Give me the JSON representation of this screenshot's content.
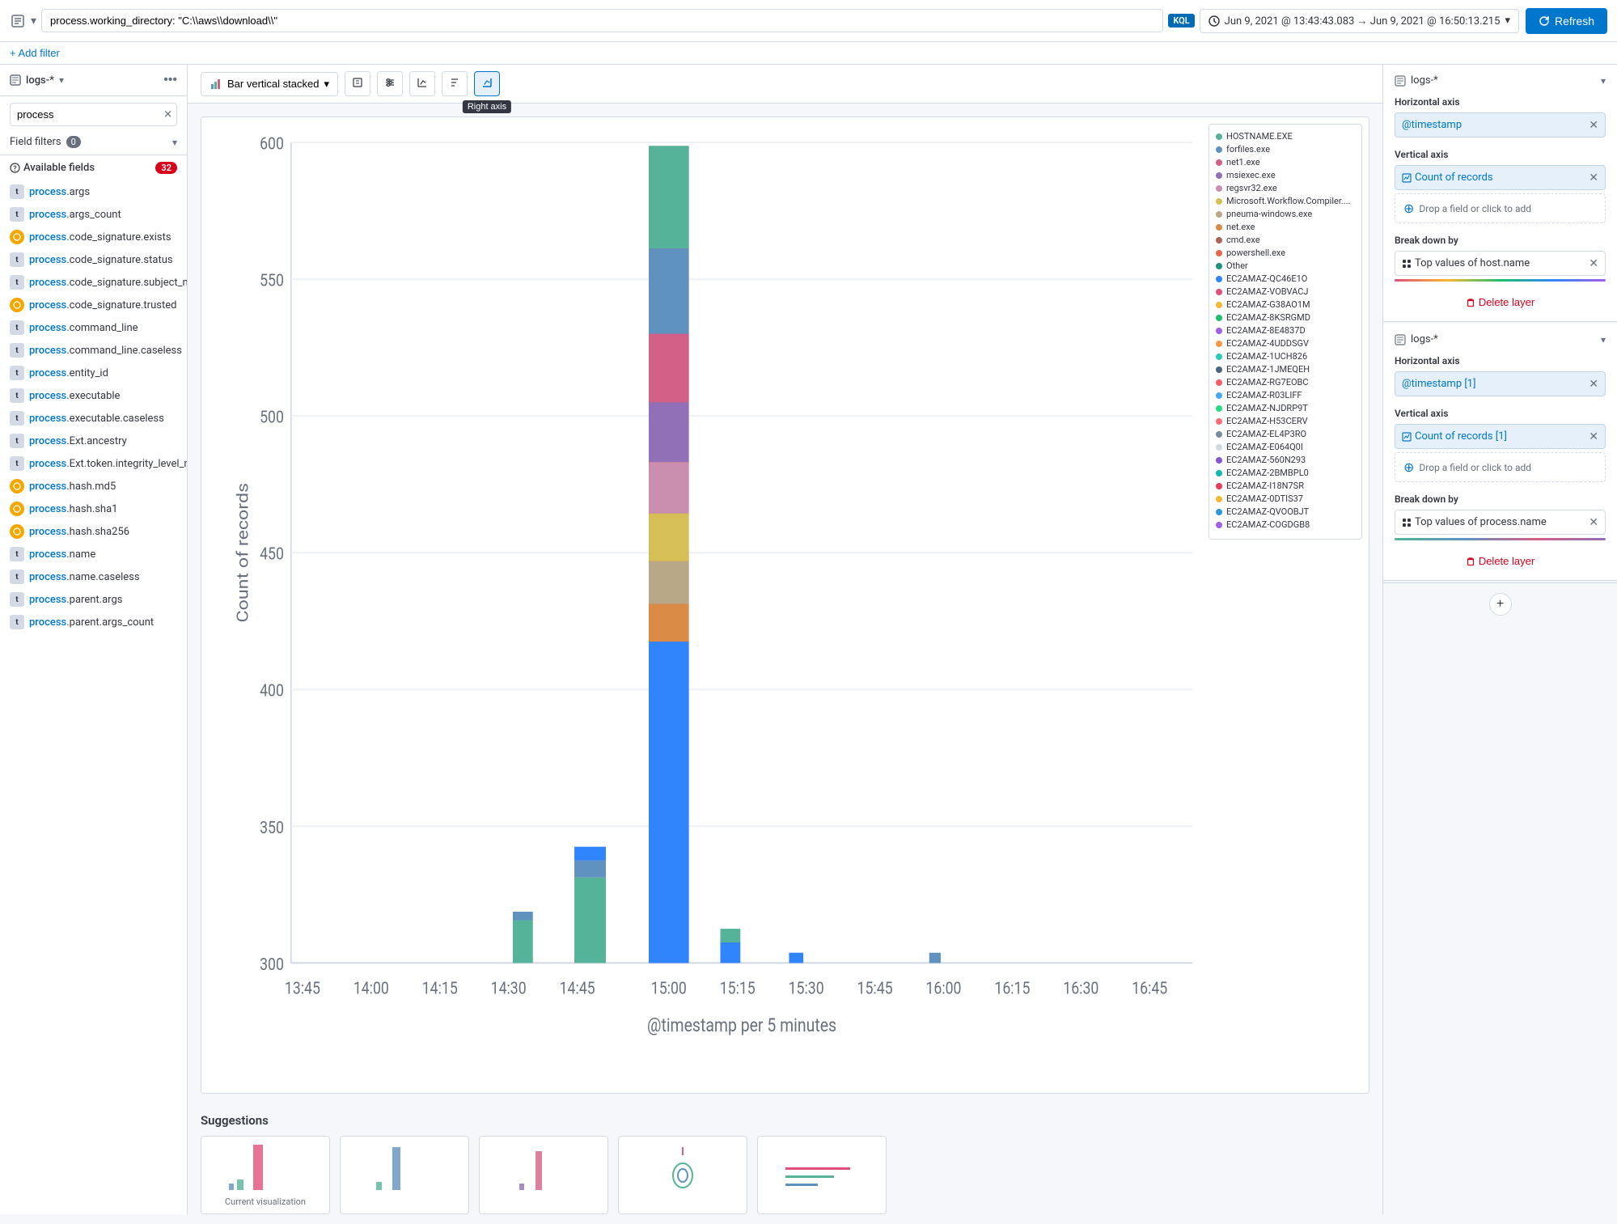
{
  "topbar": {
    "query": "process.working_directory: \"C:\\\\aws\\\\download\\\\\"",
    "kql_label": "KQL",
    "time_range": "Jun 9, 2021 @ 13:43:43.083  →  Jun 9, 2021 @ 16:50:13.215",
    "refresh_label": "Refresh"
  },
  "filter_bar": {
    "add_filter_label": "+ Add filter"
  },
  "sidebar": {
    "index": "logs-*",
    "search_placeholder": "process",
    "field_filters_label": "Field filters",
    "field_filters_count": "0",
    "available_fields_label": "Available fields",
    "available_fields_count": "32",
    "fields": [
      {
        "name": "process.args",
        "type": "t",
        "prefix": "process",
        "suffix": ".args"
      },
      {
        "name": "process.args_count",
        "type": "t",
        "prefix": "process",
        "suffix": ".args_count"
      },
      {
        "name": "process.code_signature.exists",
        "type": "bool",
        "prefix": "process",
        "suffix": ".code_signature.exists"
      },
      {
        "name": "process.code_signature.status",
        "type": "t",
        "prefix": "process",
        "suffix": ".code_signature.status"
      },
      {
        "name": "process.code_signature.subject_name",
        "type": "t",
        "prefix": "process",
        "suffix": ".code_signature.subject_name"
      },
      {
        "name": "process.code_signature.trusted",
        "type": "bool",
        "prefix": "process",
        "suffix": ".code_signature.trusted"
      },
      {
        "name": "process.command_line",
        "type": "t",
        "prefix": "process",
        "suffix": ".command_line"
      },
      {
        "name": "process.command_line.caseless",
        "type": "t",
        "prefix": "process",
        "suffix": ".command_line.caseless"
      },
      {
        "name": "process.entity_id",
        "type": "t",
        "prefix": "process",
        "suffix": ".entity_id"
      },
      {
        "name": "process.executable",
        "type": "t",
        "prefix": "process",
        "suffix": ".executable"
      },
      {
        "name": "process.executable.caseless",
        "type": "t",
        "prefix": "process",
        "suffix": ".executable.caseless"
      },
      {
        "name": "process.Ext.ancestry",
        "type": "t",
        "prefix": "process",
        "suffix": ".Ext.ancestry"
      },
      {
        "name": "process.Ext.token.integrity_level_name",
        "type": "t",
        "prefix": "process",
        "suffix": ".Ext.token.integrity_level_name"
      },
      {
        "name": "process.hash.md5",
        "type": "hash",
        "prefix": "process",
        "suffix": ".hash.md5"
      },
      {
        "name": "process.hash.sha1",
        "type": "hash",
        "prefix": "process",
        "suffix": ".hash.sha1"
      },
      {
        "name": "process.hash.sha256",
        "type": "hash",
        "prefix": "process",
        "suffix": ".hash.sha256"
      },
      {
        "name": "process.name",
        "type": "t",
        "prefix": "process",
        "suffix": ".name"
      },
      {
        "name": "process.name.caseless",
        "type": "t",
        "prefix": "process",
        "suffix": ".name.caseless"
      },
      {
        "name": "process.parent.args",
        "type": "t",
        "prefix": "process",
        "suffix": ".parent.args"
      },
      {
        "name": "process.parent.args_count",
        "type": "t",
        "prefix": "process",
        "suffix": ".parent.args_count"
      }
    ]
  },
  "chart_toolbar": {
    "chart_type": "Bar vertical stacked",
    "tooltip_label": "Right axis"
  },
  "chart": {
    "y_label": "Count of records",
    "x_label": "@timestamp per 5 minutes",
    "x_ticks": [
      "13:45",
      "14:00",
      "14:15",
      "14:30",
      "14:45",
      "15:00",
      "15:15",
      "15:30",
      "15:45",
      "16:00",
      "16:15",
      "16:30",
      "16:45"
    ]
  },
  "legend": {
    "items": [
      {
        "label": "HOSTNAME.EXE",
        "color": "#54b399"
      },
      {
        "label": "forfiles.exe",
        "color": "#6092c0"
      },
      {
        "label": "net1.exe",
        "color": "#d36086"
      },
      {
        "label": "msiexec.exe",
        "color": "#9170b8"
      },
      {
        "label": "regsvr32.exe",
        "color": "#ca8eae"
      },
      {
        "label": "Microsoft.Workflow.Compiler....",
        "color": "#d6bf57"
      },
      {
        "label": "pneuma-windows.exe",
        "color": "#b9a888"
      },
      {
        "label": "net.exe",
        "color": "#da8b45"
      },
      {
        "label": "cmd.exe",
        "color": "#aa6556"
      },
      {
        "label": "powershell.exe",
        "color": "#e7664c"
      },
      {
        "label": "Other",
        "color": "#209280"
      },
      {
        "label": "EC2AMAZ-QC46E1O",
        "color": "#3185fc"
      },
      {
        "label": "EC2AMAZ-VOBVACJ",
        "color": "#e04f79"
      },
      {
        "label": "EC2AMAZ-G38AO1M",
        "color": "#f7b731"
      },
      {
        "label": "EC2AMAZ-8KSRGMD",
        "color": "#20bf6b"
      },
      {
        "label": "EC2AMAZ-8E4837D",
        "color": "#a55eea"
      },
      {
        "label": "EC2AMAZ-4UDDSGV",
        "color": "#fd9644"
      },
      {
        "label": "EC2AMAZ-1UCH826",
        "color": "#2bcbba"
      },
      {
        "label": "EC2AMAZ-1JMEQEH",
        "color": "#4b6584"
      },
      {
        "label": "EC2AMAZ-RG7EOBC",
        "color": "#fc5c65"
      },
      {
        "label": "EC2AMAZ-R03LIFF",
        "color": "#45aaf2"
      },
      {
        "label": "EC2AMAZ-NJDRP9T",
        "color": "#26de81"
      },
      {
        "label": "EC2AMAZ-H53CERV",
        "color": "#fd6b74"
      },
      {
        "label": "EC2AMAZ-EL4P3RO",
        "color": "#778ca3"
      },
      {
        "label": "EC2AMAZ-E064Q0I",
        "color": "#d1d8e0"
      },
      {
        "label": "EC2AMAZ-560N293",
        "color": "#8854d0"
      },
      {
        "label": "EC2AMAZ-2BMBPL0",
        "color": "#0fb9b1"
      },
      {
        "label": "EC2AMAZ-I18N7SR",
        "color": "#eb3b5a"
      },
      {
        "label": "EC2AMAZ-0DTIS37",
        "color": "#f7b731"
      },
      {
        "label": "EC2AMAZ-QVOOBJT",
        "color": "#2d98da"
      },
      {
        "label": "EC2AMAZ-COGDGB8",
        "color": "#a55eea"
      }
    ]
  },
  "suggestions": {
    "title": "Suggestions",
    "current_label": "Current visualization",
    "items": [
      "",
      "",
      "",
      "",
      ""
    ]
  },
  "right_panel": {
    "layer1": {
      "index": "logs-*",
      "h_axis_label": "Horizontal axis",
      "h_axis_value": "@timestamp",
      "v_axis_label": "Vertical axis",
      "v_axis_value": "Count of records",
      "drop_label": "Drop a field or click to add",
      "breakdown_label": "Break down by",
      "breakdown_value": "Top values of host.name",
      "breakdown_gradient": "linear-gradient(to right, #e04f79, #f7b731, #20bf6b)",
      "delete_label": "Delete layer"
    },
    "layer2": {
      "index": "logs-*",
      "h_axis_label": "Horizontal axis",
      "h_axis_value": "@timestamp [1]",
      "v_axis_label": "Vertical axis",
      "v_axis_value": "Count of records [1]",
      "drop_label": "Drop a field or click to add",
      "breakdown_label": "Break down by",
      "breakdown_value": "Top values of process.name",
      "breakdown_gradient": "linear-gradient(to right, #54b399, #6092c0, #d36086)",
      "delete_label": "Delete layer"
    }
  }
}
